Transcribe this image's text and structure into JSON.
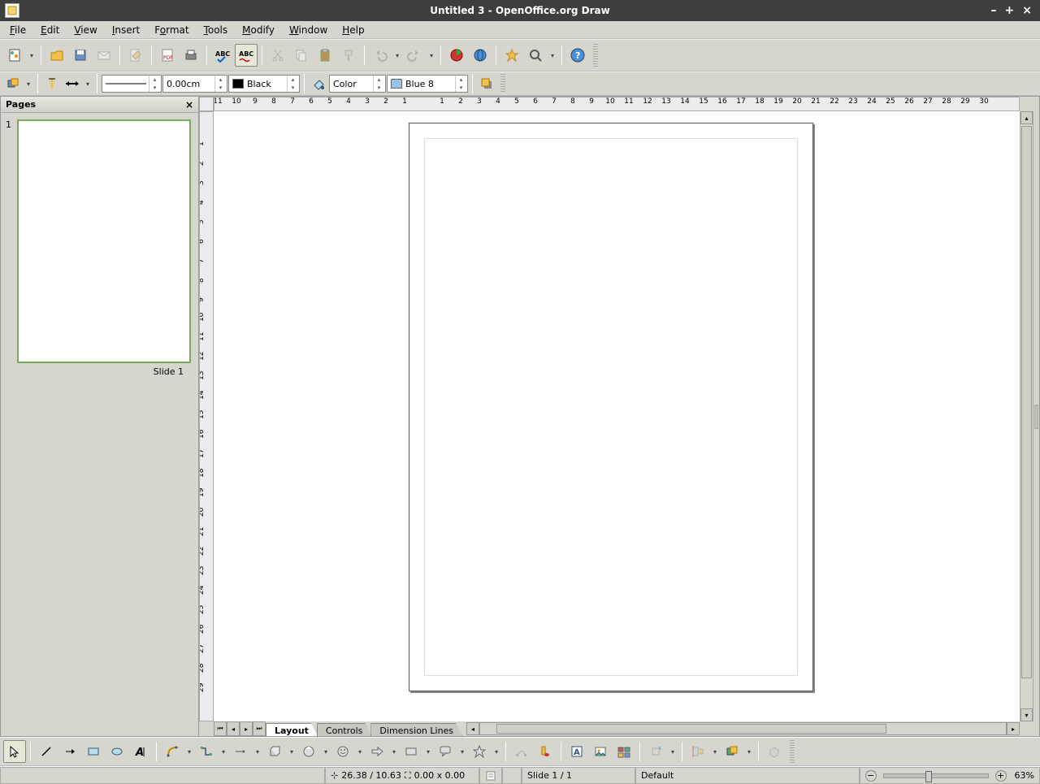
{
  "title": "Untitled 3 - OpenOffice.org Draw",
  "menu": [
    "File",
    "Edit",
    "View",
    "Insert",
    "Format",
    "Tools",
    "Modify",
    "Window",
    "Help"
  ],
  "pages_panel": {
    "title": "Pages",
    "slides": [
      {
        "num": "1",
        "label": "Slide 1"
      }
    ]
  },
  "line": {
    "width_value": "0.00cm",
    "line_color_name": "Black",
    "fill_mode": "Color",
    "fill_color_name": "Blue 8"
  },
  "tabs": {
    "layout": "Layout",
    "controls": "Controls",
    "dimension": "Dimension Lines"
  },
  "ruler_h": [
    "11",
    "10",
    "9",
    "8",
    "7",
    "6",
    "5",
    "4",
    "3",
    "2",
    "1",
    "",
    "1",
    "2",
    "3",
    "4",
    "5",
    "6",
    "7",
    "8",
    "9",
    "10",
    "11",
    "12",
    "13",
    "14",
    "15",
    "16",
    "17",
    "18",
    "19",
    "20",
    "21",
    "22",
    "23",
    "24",
    "25",
    "26",
    "27",
    "28",
    "29",
    "30"
  ],
  "ruler_v": [
    "",
    "1",
    "2",
    "3",
    "4",
    "5",
    "6",
    "7",
    "8",
    "9",
    "10",
    "11",
    "12",
    "13",
    "14",
    "15",
    "16",
    "17",
    "18",
    "19",
    "20",
    "21",
    "22",
    "23",
    "24",
    "25",
    "26",
    "27",
    "28",
    "29"
  ],
  "status": {
    "coords": "26.38 / 10.63",
    "size": "0.00 x 0.00",
    "slide": "Slide 1 / 1",
    "layout": "Default",
    "zoom": "63%"
  }
}
